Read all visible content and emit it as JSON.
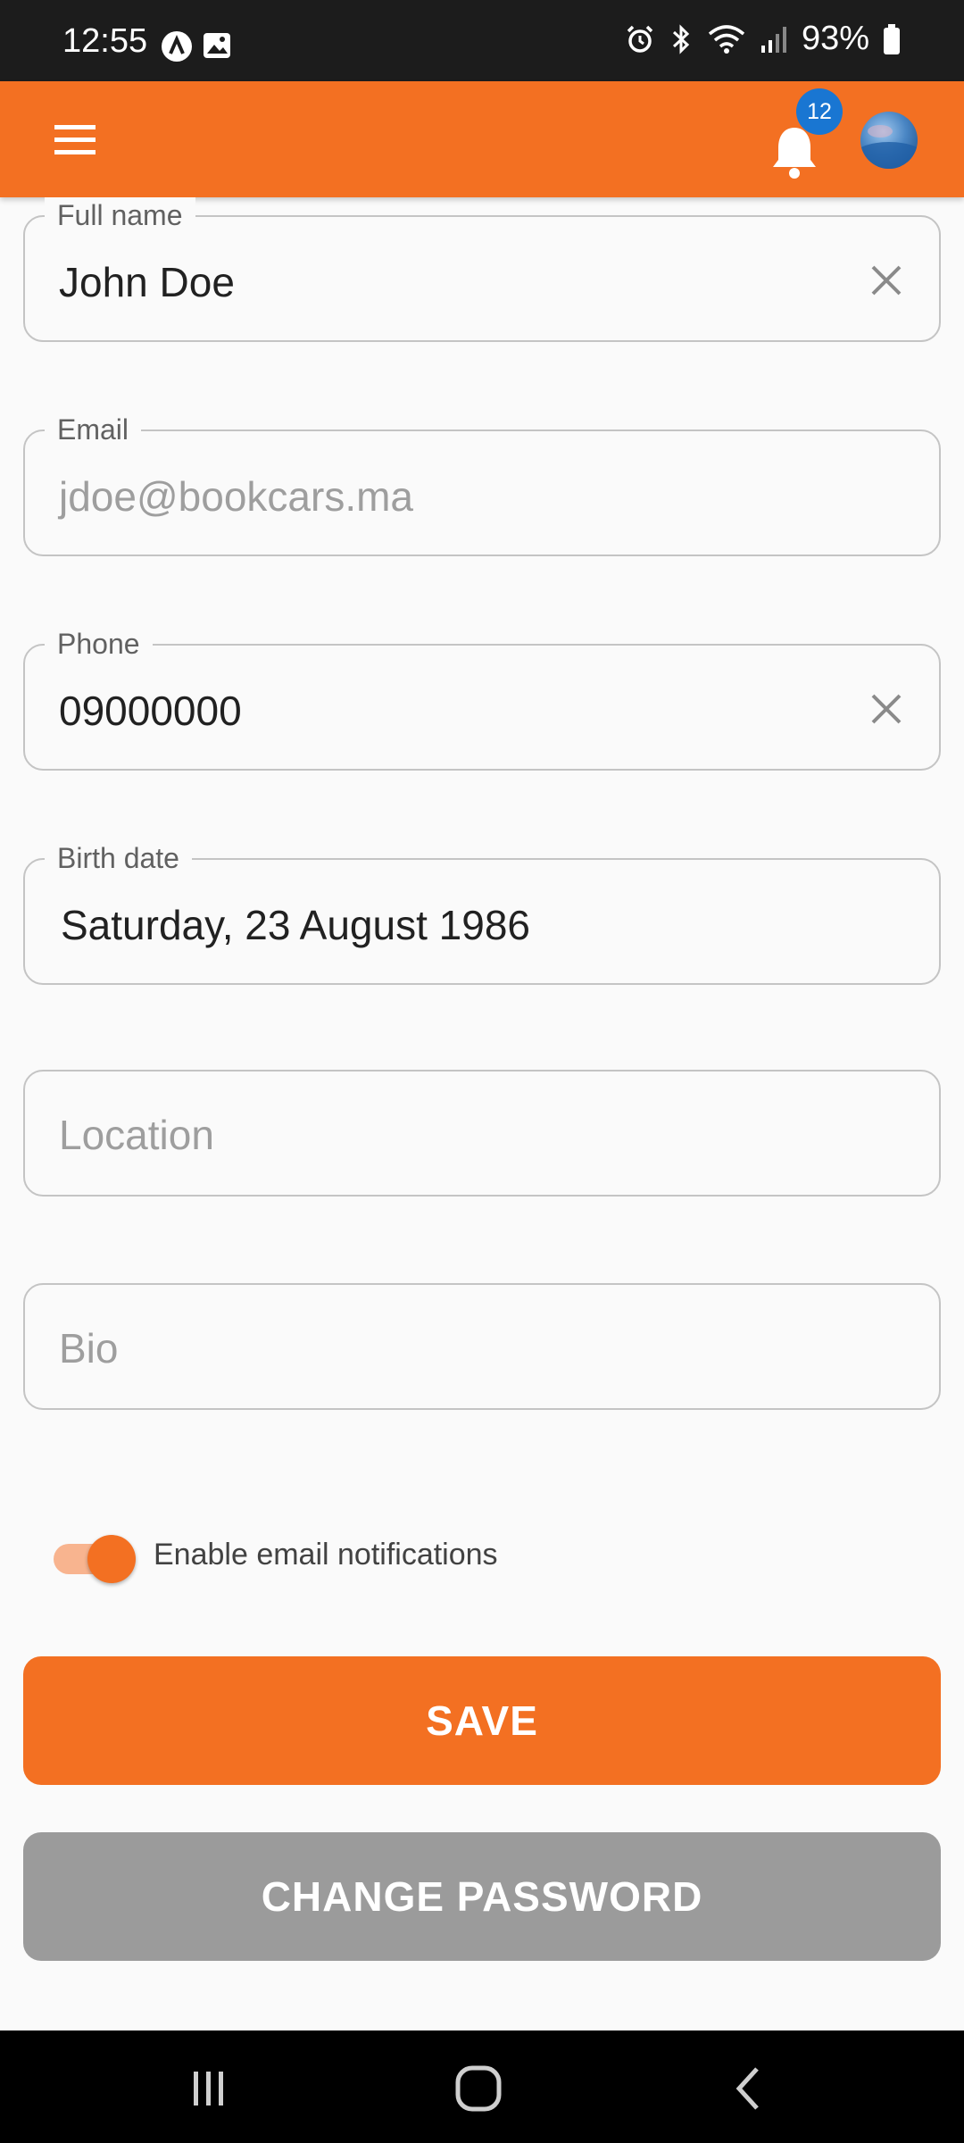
{
  "status_bar": {
    "time": "12:55",
    "battery": "93%"
  },
  "app_bar": {
    "notification_count": "12",
    "accent_color": "#f37022"
  },
  "form": {
    "full_name": {
      "label": "Full name",
      "value": "John Doe"
    },
    "email": {
      "label": "Email",
      "value": "jdoe@bookcars.ma"
    },
    "phone": {
      "label": "Phone",
      "value": "09000000"
    },
    "birth_date": {
      "label": "Birth date",
      "value": "Saturday, 23 August 1986"
    },
    "location": {
      "placeholder": "Location"
    },
    "bio": {
      "placeholder": "Bio"
    }
  },
  "notifications_toggle": {
    "label": "Enable email notifications",
    "enabled": true
  },
  "buttons": {
    "save": "SAVE",
    "change_password": "CHANGE PASSWORD"
  },
  "icons": {
    "menu": "menu-icon",
    "bell": "bell-icon",
    "clear": "close-icon",
    "nav_recents": "recents-icon",
    "nav_home": "home-icon",
    "nav_back": "back-icon"
  }
}
